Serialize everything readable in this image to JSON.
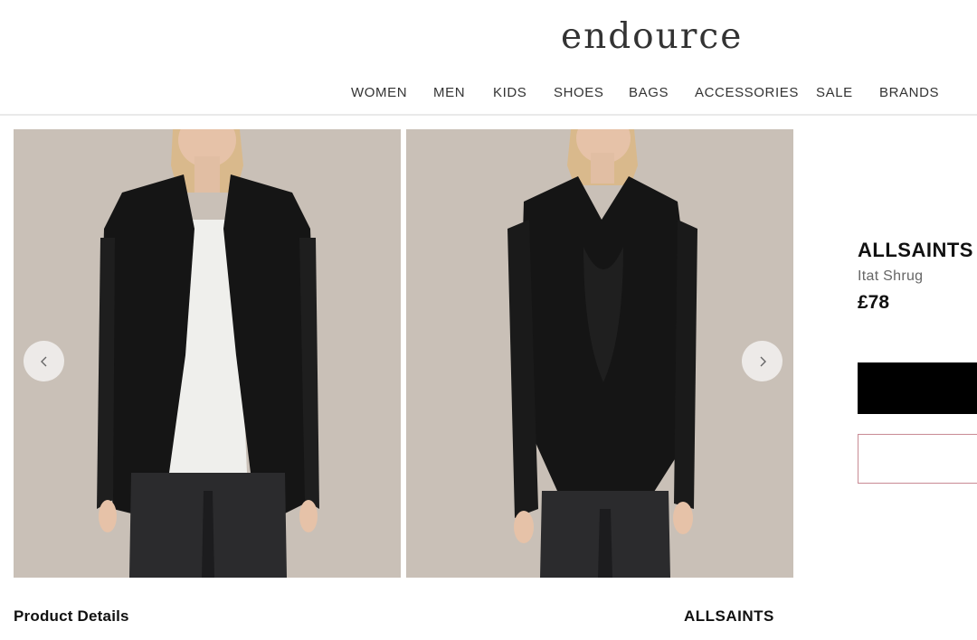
{
  "site": {
    "logo": "endource"
  },
  "nav": [
    {
      "label": "WOMEN"
    },
    {
      "label": "MEN"
    },
    {
      "label": "KIDS"
    },
    {
      "label": "SHOES"
    },
    {
      "label": "BAGS"
    },
    {
      "label": "ACCESSORIES"
    },
    {
      "label": "SALE"
    },
    {
      "label": "BRANDS"
    }
  ],
  "gallery": {
    "prev_icon": "chevron-left-icon",
    "next_icon": "chevron-right-icon"
  },
  "product": {
    "brand": "ALLSAINTS",
    "name": "Itat Shrug",
    "price": "£78"
  },
  "details": {
    "title": "Product Details",
    "brand": "ALLSAINTS"
  },
  "colors": {
    "photo_background": "#c8bfb6",
    "garment": "#141414",
    "primary_button": "#000000",
    "outline_button_border": "#c88a94"
  }
}
